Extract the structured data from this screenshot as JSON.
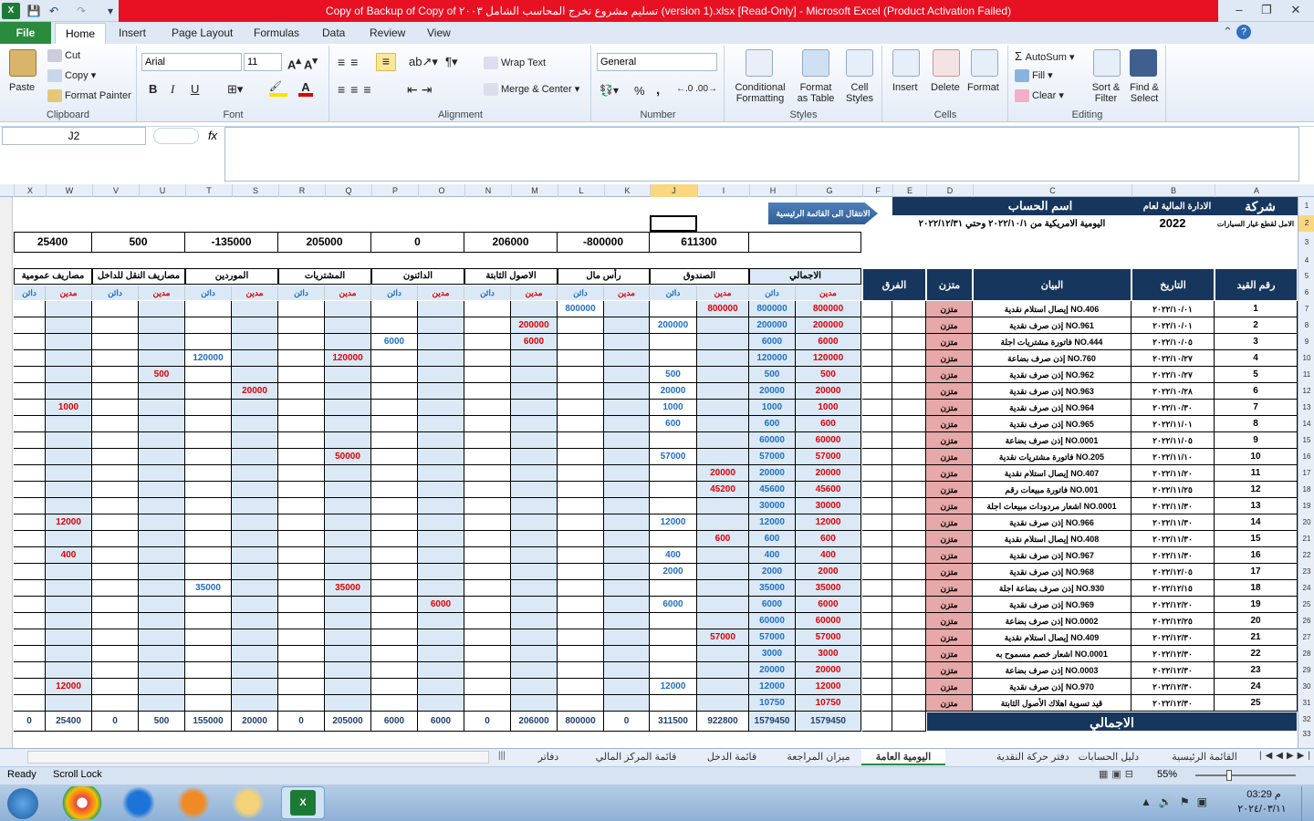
{
  "window": {
    "title": "Copy of Backup of Copy of تسليم مشروع تخرج المحاسب الشامل ٢٠٠٣ (version 1).xlsx  [Read-Only]  -  Microsoft Excel (Product Activation Failed)",
    "minimize": "–",
    "restore": "❐",
    "close": "✕"
  },
  "tabs": [
    "File",
    "Home",
    "Insert",
    "Page Layout",
    "Formulas",
    "Data",
    "Review",
    "View"
  ],
  "ribbon": {
    "clipboard": {
      "label": "Clipboard",
      "paste": "Paste",
      "cut": "Cut",
      "copy": "Copy",
      "format_painter": "Format Painter"
    },
    "font": {
      "label": "Font",
      "family": "Arial",
      "size": "11",
      "bold": "B",
      "italic": "I",
      "underline": "U"
    },
    "alignment": {
      "label": "Alignment",
      "wrap": "Wrap Text",
      "merge": "Merge & Center"
    },
    "number": {
      "label": "Number",
      "format": "General",
      "percent": "%",
      "comma": ","
    },
    "styles": {
      "label": "Styles",
      "conditional": "Conditional",
      "conditional2": "Formatting",
      "format_table": "Format",
      "format_table2": "as Table",
      "cell_styles": "Cell",
      "cell_styles2": "Styles"
    },
    "cells": {
      "label": "Cells",
      "insert": "Insert",
      "delete": "Delete",
      "format": "Format"
    },
    "editing": {
      "label": "Editing",
      "autosum": "AutoSum",
      "fill": "Fill",
      "clear": "Clear",
      "sort": "Sort &",
      "sort2": "Filter",
      "find": "Find &",
      "find2": "Select"
    }
  },
  "formula_bar": {
    "name_box": "J2",
    "fx": "fx",
    "value": ""
  },
  "columns": [
    "X",
    "W",
    "V",
    "U",
    "T",
    "S",
    "R",
    "Q",
    "P",
    "O",
    "N",
    "M",
    "L",
    "K",
    "J",
    "I",
    "H",
    "G",
    "F",
    "E",
    "D",
    "C",
    "B",
    "A"
  ],
  "sheet": {
    "company": "شركة",
    "company_sub": "الامل لقطع غيار السيارات",
    "mgmt": "الادارة المالية لعام",
    "year": "2022",
    "account_name": "اسم الحساب",
    "period": "اليومية الامريكية من ٢٠٢٢/١٠/١ وحتي ٢٠٢٢/١٢/٣١",
    "goto_main": "الانتقال الى القائمة الرئيسية",
    "top_values": [
      "25400",
      "500",
      "-135000",
      "205000",
      "0",
      "206000",
      "-800000",
      "611300",
      ""
    ],
    "headers": {
      "entry_no": "رقم القيد",
      "date": "التاريخ",
      "statement": "البيان",
      "balanced": "متزن",
      "diff": "الفرق"
    },
    "account_groups": [
      "الاجمالي",
      "الصندوق",
      "رأس مال",
      "الاصول الثابتة",
      "الدائنون",
      "المشتريات",
      "الموردين",
      "مصاريف النقل للداخل",
      "مصاريف عمومية"
    ],
    "debit": "مدين",
    "credit": "دائن",
    "total_label": "الاجمالي",
    "rows": [
      {
        "n": "1",
        "date": "٢٠٢٢/١٠/٠١",
        "desc": "إيصال استلام نقدية NO.406",
        "bal": "متزن",
        "v": [
          "800000",
          "800000",
          "800000",
          "",
          "",
          "800000",
          "",
          "",
          "",
          "",
          "",
          "",
          "",
          "",
          "",
          "",
          "",
          ""
        ]
      },
      {
        "n": "2",
        "date": "٢٠٢٢/١٠/٠١",
        "desc": "إذن صرف نقدية NO.961",
        "bal": "متزن",
        "v": [
          "200000",
          "200000",
          "",
          "200000",
          "",
          "",
          "200000",
          "",
          "",
          "",
          "",
          "",
          "",
          "",
          "",
          "",
          "",
          ""
        ]
      },
      {
        "n": "3",
        "date": "٢٠٢٢/١٠/٠٥",
        "desc": "فاتورة مشتريات اجلة NO.444",
        "bal": "متزن",
        "v": [
          "6000",
          "6000",
          "",
          "",
          "",
          "",
          "6000",
          "",
          "",
          "6000",
          "",
          "",
          "",
          "",
          "",
          "",
          "",
          ""
        ]
      },
      {
        "n": "4",
        "date": "٢٠٢٢/١٠/٢٧",
        "desc": "إذن صرف بضاعة NO.760",
        "bal": "متزن",
        "v": [
          "120000",
          "120000",
          "",
          "",
          "",
          "",
          "",
          "",
          "",
          "",
          "120000",
          "",
          "",
          "120000",
          "",
          "",
          "",
          ""
        ]
      },
      {
        "n": "5",
        "date": "٢٠٢٢/١٠/٢٧",
        "desc": "إذن صرف نقدية NO.962",
        "bal": "متزن",
        "v": [
          "500",
          "500",
          "",
          "500",
          "",
          "",
          "",
          "",
          "",
          "",
          "",
          "",
          "",
          "",
          "500",
          "",
          "",
          ""
        ]
      },
      {
        "n": "6",
        "date": "٢٠٢٢/١٠/٢٨",
        "desc": "إذن صرف نقدية NO.963",
        "bal": "متزن",
        "v": [
          "20000",
          "20000",
          "",
          "20000",
          "",
          "",
          "",
          "",
          "",
          "",
          "",
          "",
          "20000",
          "",
          "",
          "",
          "",
          ""
        ]
      },
      {
        "n": "7",
        "date": "٢٠٢٢/١٠/٣٠",
        "desc": "إذن صرف نقدية NO.964",
        "bal": "متزن",
        "v": [
          "1000",
          "1000",
          "",
          "1000",
          "",
          "",
          "",
          "",
          "",
          "",
          "",
          "",
          "",
          "",
          "",
          "",
          "1000",
          ""
        ]
      },
      {
        "n": "8",
        "date": "٢٠٢٢/١١/٠١",
        "desc": "إذن صرف نقدية NO.965",
        "bal": "متزن",
        "v": [
          "600",
          "600",
          "",
          "600",
          "",
          "",
          "",
          "",
          "",
          "",
          "",
          "",
          "",
          "",
          "",
          "",
          "",
          ""
        ]
      },
      {
        "n": "9",
        "date": "٢٠٢٢/١١/٠٥",
        "desc": "إذن صرف بضاعة NO.0001",
        "bal": "متزن",
        "v": [
          "60000",
          "60000",
          "",
          "",
          "",
          "",
          "",
          "",
          "",
          "",
          "",
          "",
          "",
          "",
          "",
          "",
          "",
          ""
        ]
      },
      {
        "n": "10",
        "date": "٢٠٢٢/١١/١٠",
        "desc": "فاتورة مشتريات نقدية NO.205",
        "bal": "متزن",
        "v": [
          "57000",
          "57000",
          "",
          "57000",
          "",
          "",
          "",
          "",
          "",
          "",
          "50000",
          "",
          "",
          "",
          "",
          "",
          "",
          ""
        ]
      },
      {
        "n": "11",
        "date": "٢٠٢٢/١١/٢٠",
        "desc": "إيصال استلام نقدية NO.407",
        "bal": "متزن",
        "v": [
          "20000",
          "20000",
          "20000",
          "",
          "",
          "",
          "",
          "",
          "",
          "",
          "",
          "",
          "",
          "",
          "",
          "",
          "",
          ""
        ]
      },
      {
        "n": "12",
        "date": "٢٠٢٢/١١/٢٥",
        "desc": "فاتورة مبيعات رقم NO.001",
        "bal": "متزن",
        "v": [
          "45600",
          "45600",
          "45200",
          "",
          "",
          "",
          "",
          "",
          "",
          "",
          "",
          "",
          "",
          "",
          "",
          "",
          "",
          ""
        ]
      },
      {
        "n": "13",
        "date": "٢٠٢٢/١١/٣٠",
        "desc": "اشعار مردودات مبيعات اجلة NO.0001",
        "bal": "متزن",
        "v": [
          "30000",
          "30000",
          "",
          "",
          "",
          "",
          "",
          "",
          "",
          "",
          "",
          "",
          "",
          "",
          "",
          "",
          "",
          ""
        ]
      },
      {
        "n": "14",
        "date": "٢٠٢٢/١١/٣٠",
        "desc": "إذن صرف نقدية NO.966",
        "bal": "متزن",
        "v": [
          "12000",
          "12000",
          "",
          "12000",
          "",
          "",
          "",
          "",
          "",
          "",
          "",
          "",
          "",
          "",
          "",
          "",
          "12000",
          ""
        ]
      },
      {
        "n": "15",
        "date": "٢٠٢٢/١١/٣٠",
        "desc": "إيصال استلام نقدية NO.408",
        "bal": "متزن",
        "v": [
          "600",
          "600",
          "600",
          "",
          "",
          "",
          "",
          "",
          "",
          "",
          "",
          "",
          "",
          "",
          "",
          "",
          "",
          ""
        ]
      },
      {
        "n": "16",
        "date": "٢٠٢٢/١١/٣٠",
        "desc": "إذن صرف نقدية NO.967",
        "bal": "متزن",
        "v": [
          "400",
          "400",
          "",
          "400",
          "",
          "",
          "",
          "",
          "",
          "",
          "",
          "",
          "",
          "",
          "",
          "",
          "400",
          ""
        ]
      },
      {
        "n": "17",
        "date": "٢٠٢٢/١٢/٠٥",
        "desc": "إذن صرف نقدية NO.968",
        "bal": "متزن",
        "v": [
          "2000",
          "2000",
          "",
          "2000",
          "",
          "",
          "",
          "",
          "",
          "",
          "",
          "",
          "",
          "",
          "",
          "",
          "",
          ""
        ]
      },
      {
        "n": "18",
        "date": "٢٠٢٢/١٢/١٥",
        "desc": "إذن صرف بضاعة اجلة NO.930",
        "bal": "متزن",
        "v": [
          "35000",
          "35000",
          "",
          "",
          "",
          "",
          "",
          "",
          "",
          "",
          "35000",
          "",
          "",
          "35000",
          "",
          "",
          "",
          ""
        ]
      },
      {
        "n": "19",
        "date": "٢٠٢٢/١٢/٢٠",
        "desc": "إذن صرف نقدية NO.969",
        "bal": "متزن",
        "v": [
          "6000",
          "6000",
          "",
          "6000",
          "",
          "",
          "",
          "",
          "6000",
          "",
          "",
          "",
          "",
          "",
          "",
          "",
          "",
          ""
        ]
      },
      {
        "n": "20",
        "date": "٢٠٢٢/١٢/٢٥",
        "desc": "إذن صرف بضاعة NO.0002",
        "bal": "متزن",
        "v": [
          "60000",
          "60000",
          "",
          "",
          "",
          "",
          "",
          "",
          "",
          "",
          "",
          "",
          "",
          "",
          "",
          "",
          "",
          ""
        ]
      },
      {
        "n": "21",
        "date": "٢٠٢٢/١٢/٣٠",
        "desc": "إيصال استلام نقدية NO.409",
        "bal": "متزن",
        "v": [
          "57000",
          "57000",
          "57000",
          "",
          "",
          "",
          "",
          "",
          "",
          "",
          "",
          "",
          "",
          "",
          "",
          "",
          "",
          ""
        ]
      },
      {
        "n": "22",
        "date": "٢٠٢٢/١٢/٣٠",
        "desc": "اشعار خصم مسموح به NO.0001",
        "bal": "متزن",
        "v": [
          "3000",
          "3000",
          "",
          "",
          "",
          "",
          "",
          "",
          "",
          "",
          "",
          "",
          "",
          "",
          "",
          "",
          "",
          ""
        ]
      },
      {
        "n": "23",
        "date": "٢٠٢٢/١٢/٣٠",
        "desc": "إذن صرف بضاعة NO.0003",
        "bal": "متزن",
        "v": [
          "20000",
          "20000",
          "",
          "",
          "",
          "",
          "",
          "",
          "",
          "",
          "",
          "",
          "",
          "",
          "",
          "",
          "",
          ""
        ]
      },
      {
        "n": "24",
        "date": "٢٠٢٢/١٢/٣٠",
        "desc": "إذن صرف نقدية NO.970",
        "bal": "متزن",
        "v": [
          "12000",
          "12000",
          "",
          "12000",
          "",
          "",
          "",
          "",
          "",
          "",
          "",
          "",
          "",
          "",
          "",
          "",
          "12000",
          ""
        ]
      },
      {
        "n": "25",
        "date": "٢٠٢٢/١٢/٣٠",
        "desc": "قيد تسوية اهلاك الأصول الثابتة",
        "bal": "متزن",
        "v": [
          "10750",
          "10750",
          "",
          "",
          "",
          "",
          "",
          "",
          "",
          "",
          "",
          "",
          "",
          "",
          "",
          "",
          "",
          ""
        ]
      }
    ],
    "totals": [
      "1579450",
      "1579450",
      "922800",
      "311500",
      "0",
      "800000",
      "206000",
      "0",
      "6000",
      "6000",
      "205000",
      "0",
      "20000",
      "155000",
      "500",
      "0",
      "25400",
      "0"
    ]
  },
  "sheet_tabs": [
    "القائمة الرئيسية",
    "دليل الحسابات",
    "دفتر حركة النقدية",
    "اليومية العامة",
    "ميزان المراجعة",
    "قائمة الدخل",
    "قائمة المركز المالي",
    "دفاتر"
  ],
  "active_sheet": "اليومية العامة",
  "status": {
    "ready": "Ready",
    "scroll_lock": "Scroll Lock",
    "zoom": "55%"
  },
  "clock": {
    "time": "03:29 م",
    "date": "٢٠٢٤/٠٣/١١"
  },
  "colors": {
    "dark_header": "#17365d",
    "excel_green": "#2a8a3e",
    "debit_red": "#e00000",
    "credit_blue": "#1f6fc4",
    "cell_blue": "#dbe9f7",
    "balanced_pink": "#e6a8a8"
  }
}
